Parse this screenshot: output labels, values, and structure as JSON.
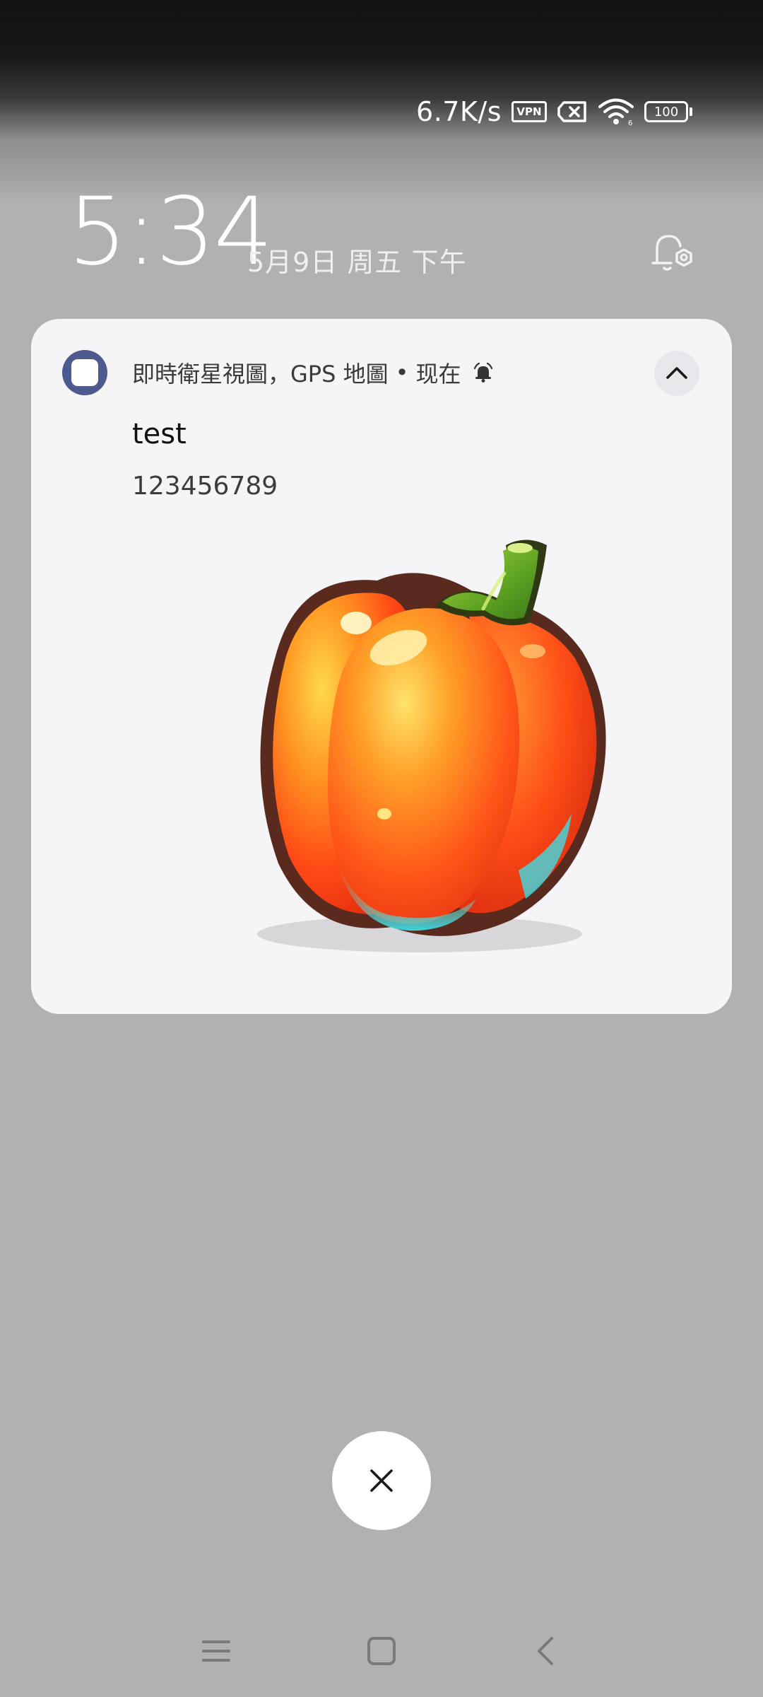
{
  "status_bar": {
    "net_speed": "6.7K/s",
    "vpn_label": "VPN",
    "battery_level": "100",
    "icons": [
      "vpn-icon",
      "sim-off-icon",
      "wifi-icon",
      "battery-icon"
    ]
  },
  "lockscreen": {
    "time": "5:34",
    "date": "5月9日 周五 下午"
  },
  "notification": {
    "app_name": "即時衛星視圖，GPS 地圖",
    "separator": "•",
    "time": "现在",
    "title": "test",
    "body": "123456789",
    "image_icon": "bell-pepper-image",
    "app_icon_color": "#4d5a8f"
  },
  "colors": {
    "background": "#b1b1b1",
    "card": "#f5f5f7",
    "accent": "#4d5a8f"
  }
}
